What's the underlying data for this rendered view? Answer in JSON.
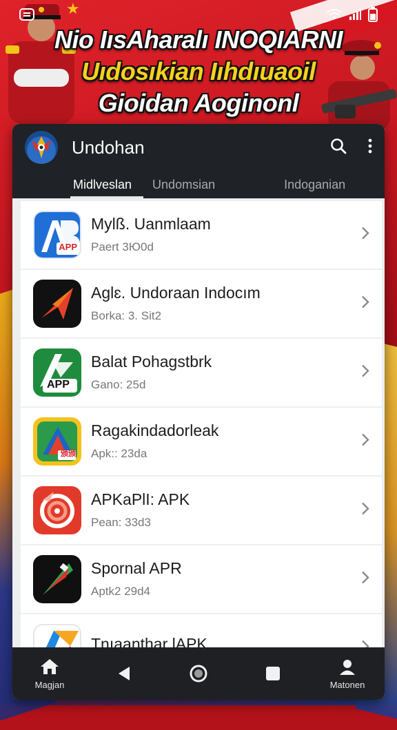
{
  "headline": {
    "line1": "Nio IısAharalı INOQIARNI",
    "line2": "Uıdosıkian Iıhdıuaoil",
    "line3": "Gioidan Aoginonl"
  },
  "app": {
    "title": "Undohan",
    "tabs": [
      "Midlveslan",
      "Undomsian",
      "Indoganian"
    ],
    "active_tab_index": 0
  },
  "items": [
    {
      "title": "Mylß. Uanmlaam",
      "sub": "Paert 3Ю0d",
      "icon": "ab-app-icon",
      "icon_text": "AB",
      "badge": "APP"
    },
    {
      "title": "Aglɛ. Undoraan Indocım",
      "sub": "Borka: 3. Sit2",
      "icon": "arrow-red-icon"
    },
    {
      "title": "Balat Pohagstbrk",
      "sub": "Gano: 25d",
      "icon": "green-app-icon",
      "badge": "APP"
    },
    {
      "title": "Ragakindadorleak",
      "sub": "Apk:: 23da",
      "icon": "triangle-yellow-icon",
      "badge": "颁颁"
    },
    {
      "title": "APKaPlI: APK",
      "sub": "Pean: 33d3",
      "icon": "swirl-red-icon"
    },
    {
      "title": "Spornal APR",
      "sub": "Aptk2 29d4",
      "icon": "flag-dark-icon"
    },
    {
      "title": "Tnıaanthar lAPK",
      "sub": "",
      "icon": "multicolor-icon"
    }
  ],
  "bottom_nav": {
    "left_label": "Magjan",
    "right_label": "Matonen"
  },
  "colors": {
    "appbar": "#1f2226",
    "headline_yellow": "#f6d21e",
    "background_red": "#c4161f"
  }
}
